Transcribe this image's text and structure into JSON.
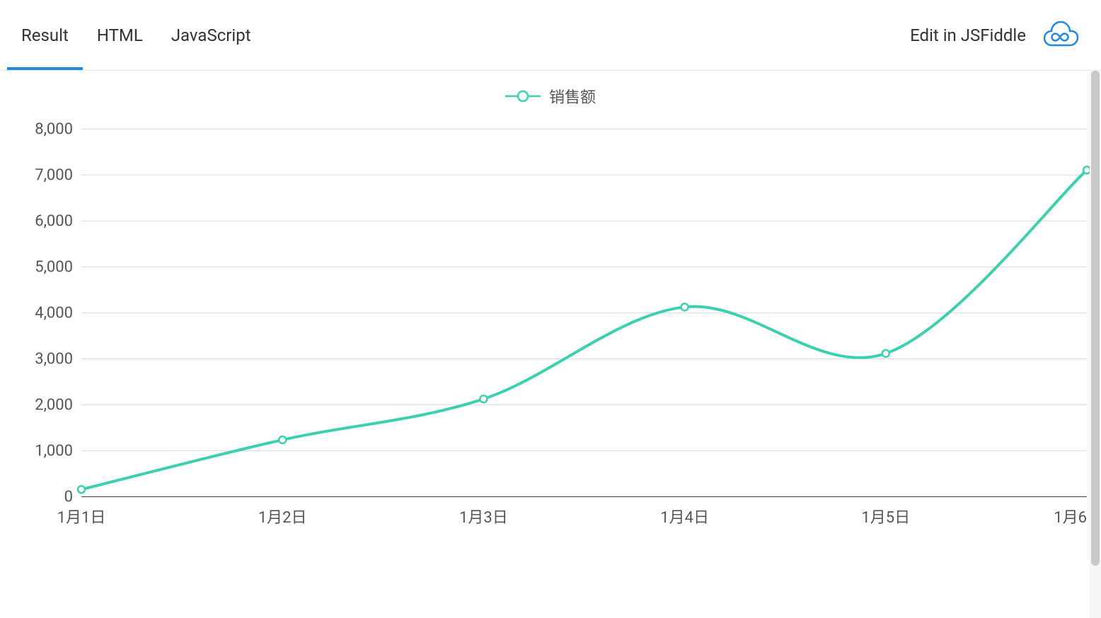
{
  "header": {
    "tabs": [
      {
        "label": "Result",
        "active": true
      },
      {
        "label": "HTML",
        "active": false
      },
      {
        "label": "JavaScript",
        "active": false
      }
    ],
    "edit_link": "Edit in JSFiddle"
  },
  "legend": {
    "series_name": "销售额"
  },
  "colors": {
    "accent": "#3bd1b0",
    "link": "#1e88e5"
  },
  "chart_data": {
    "type": "line",
    "series_name": "销售额",
    "categories": [
      "1月1日",
      "1月2日",
      "1月3日",
      "1月4日",
      "1月5日",
      "1月6"
    ],
    "values": [
      150,
      1230,
      2120,
      4120,
      3110,
      7100
    ],
    "y_ticks": [
      0,
      1000,
      2000,
      3000,
      4000,
      5000,
      6000,
      7000,
      8000
    ],
    "y_tick_labels": [
      "0",
      "1,000",
      "2,000",
      "3,000",
      "4,000",
      "5,000",
      "6,000",
      "7,000",
      "8,000"
    ],
    "ylim": [
      0,
      8000
    ],
    "smooth": true
  }
}
